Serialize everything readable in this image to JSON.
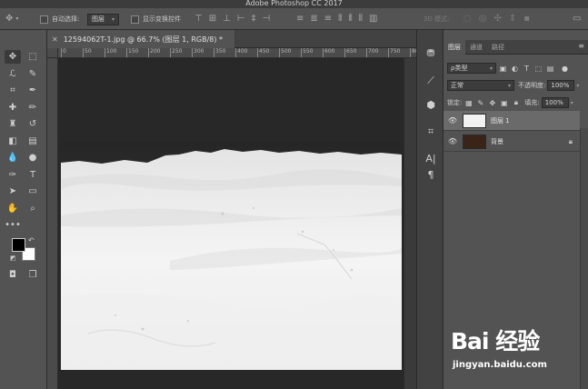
{
  "window": {
    "title": "Adobe Photoshop CC 2017"
  },
  "options_bar": {
    "auto_select_label": "自动选择:",
    "auto_select_value": "图层",
    "show_transform_label": "显示变换控件",
    "mode_3d_label": "3D 模式:"
  },
  "document": {
    "tab_title": "12594062T-1.jpg @ 66.7% (图层 1, RGB/8) *",
    "ruler_ticks": [
      "0",
      "50",
      "100",
      "150",
      "200",
      "250",
      "300",
      "350",
      "400",
      "450",
      "500",
      "550",
      "600",
      "650",
      "700",
      "750",
      "800"
    ]
  },
  "tools": [
    {
      "name": "move-tool",
      "glyph": "✥"
    },
    {
      "name": "marquee-tool",
      "glyph": "⬚"
    },
    {
      "name": "lasso-tool",
      "glyph": "ℒ"
    },
    {
      "name": "quick-select-tool",
      "glyph": "✎"
    },
    {
      "name": "crop-tool",
      "glyph": "⌗"
    },
    {
      "name": "eyedropper-tool",
      "glyph": "✒"
    },
    {
      "name": "healing-brush-tool",
      "glyph": "✚"
    },
    {
      "name": "brush-tool",
      "glyph": "✏"
    },
    {
      "name": "clone-stamp-tool",
      "glyph": "♜"
    },
    {
      "name": "history-brush-tool",
      "glyph": "↺"
    },
    {
      "name": "eraser-tool",
      "glyph": "◧"
    },
    {
      "name": "gradient-tool",
      "glyph": "▤"
    },
    {
      "name": "blur-tool",
      "glyph": "💧"
    },
    {
      "name": "dodge-tool",
      "glyph": "●"
    },
    {
      "name": "pen-tool",
      "glyph": "✑"
    },
    {
      "name": "type-tool",
      "glyph": "T"
    },
    {
      "name": "path-select-tool",
      "glyph": "➤"
    },
    {
      "name": "shape-tool",
      "glyph": "▭"
    },
    {
      "name": "hand-tool",
      "glyph": "✋"
    },
    {
      "name": "zoom-tool",
      "glyph": "⌕"
    }
  ],
  "layers_panel": {
    "tabs": [
      "图层",
      "通道",
      "路径"
    ],
    "filter_kind": "ρ类型",
    "blend_mode": "正常",
    "opacity_label": "不透明度:",
    "opacity_value": "100%",
    "lock_label": "锁定:",
    "fill_label": "填充:",
    "fill_value": "100%",
    "layers": [
      {
        "name": "图层 1",
        "selected": true,
        "locked": false
      },
      {
        "name": "背景",
        "selected": false,
        "locked": true
      }
    ]
  },
  "watermark": {
    "logo": "Bai 经验",
    "url": "jingyan.baidu.com"
  },
  "colors": {
    "ui_dark": "#383838",
    "panel": "#535353",
    "selected_layer": "#6a6a6a",
    "foreground": "#000000",
    "background": "#ffffff"
  }
}
